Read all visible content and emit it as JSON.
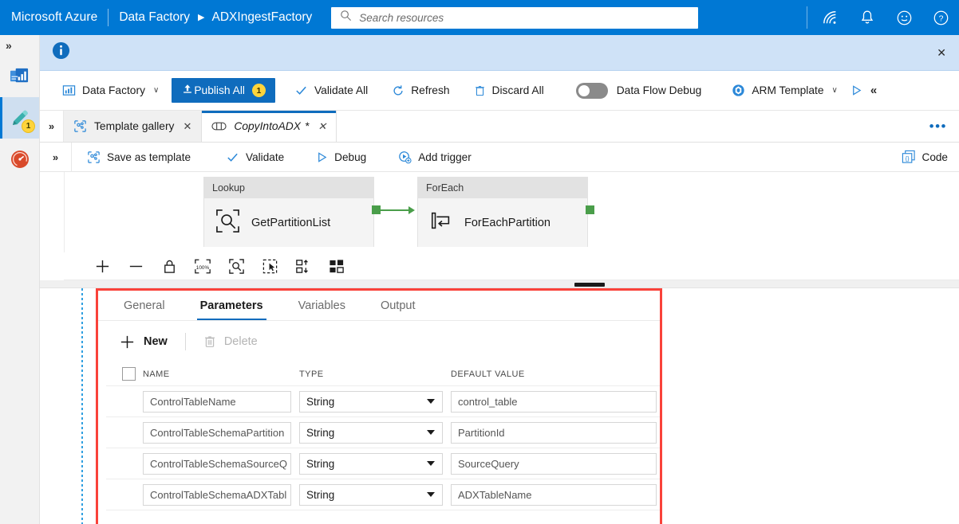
{
  "header": {
    "brand": "Microsoft Azure",
    "breadcrumb_service": "Data Factory",
    "breadcrumb_sep": "▶",
    "breadcrumb_resource": "ADXIngestFactory",
    "search_placeholder": "Search resources",
    "icons": [
      "cloud-shell-icon",
      "notifications-bell-icon",
      "feedback-smiley-icon",
      "help-question-icon"
    ]
  },
  "rail": {
    "expand_glyph": "»",
    "items": [
      {
        "name": "home-overview-icon",
        "badge": ""
      },
      {
        "name": "author-pencil-icon",
        "badge": "1"
      },
      {
        "name": "monitor-gauge-icon",
        "badge": ""
      }
    ]
  },
  "infobar": {
    "icon": "info-circle-icon",
    "close": "✕"
  },
  "factory_toolbar": {
    "data_factory_label": "Data Factory",
    "data_factory_chevron": "∨",
    "publish_label": "Publish All",
    "publish_badge": "1",
    "validate_all_label": "Validate All",
    "refresh_label": "Refresh",
    "discard_all_label": "Discard All",
    "data_flow_debug_label": "Data Flow Debug",
    "data_flow_debug_state": "off",
    "arm_template_label": "ARM Template",
    "arm_chevron": "∨",
    "collapse_glyph": "«"
  },
  "tabs": {
    "expand_glyph": "»",
    "items": [
      {
        "label": "Template gallery",
        "icon": "template-gallery-icon",
        "close": "✕",
        "active": false,
        "dirty": ""
      },
      {
        "label": "CopyIntoADX",
        "icon": "pipeline-icon",
        "close": "✕",
        "active": true,
        "dirty": "*"
      }
    ],
    "overflow": "•••"
  },
  "pipeline_bar": {
    "expand_glyph": "»",
    "save_as_template_label": "Save as template",
    "validate_label": "Validate",
    "debug_label": "Debug",
    "add_trigger_label": "Add trigger",
    "code_label": "Code"
  },
  "canvas": {
    "nodes": [
      {
        "type": "Lookup",
        "name": "GetPartitionList",
        "icon": "lookup-magnifier-icon"
      },
      {
        "type": "ForEach",
        "name": "ForEachPartition",
        "icon": "foreach-loop-icon"
      }
    ],
    "connector_color": "#4a9e4a",
    "tools": [
      "zoom-in-icon",
      "zoom-out-icon",
      "lock-icon",
      "zoom-100-icon",
      "zoom-to-fit-icon",
      "select-pointer-icon",
      "auto-align-icon",
      "layers-icon"
    ]
  },
  "panel": {
    "highlight_color": "#f9423a",
    "tabs": [
      {
        "label": "General",
        "active": false
      },
      {
        "label": "Parameters",
        "active": true
      },
      {
        "label": "Variables",
        "active": false
      },
      {
        "label": "Output",
        "active": false
      }
    ],
    "new_label": "New",
    "delete_label": "Delete",
    "delete_disabled": true,
    "columns": [
      "NAME",
      "TYPE",
      "DEFAULT VALUE"
    ],
    "rows": [
      {
        "name": "ControlTableName",
        "type": "String",
        "default": "control_table"
      },
      {
        "name": "ControlTableSchemaPartition",
        "type": "String",
        "default": "PartitionId"
      },
      {
        "name": "ControlTableSchemaSourceQ",
        "type": "String",
        "default": "SourceQuery"
      },
      {
        "name": "ControlTableSchemaADXTabl",
        "type": "String",
        "default": "ADXTableName"
      }
    ]
  }
}
